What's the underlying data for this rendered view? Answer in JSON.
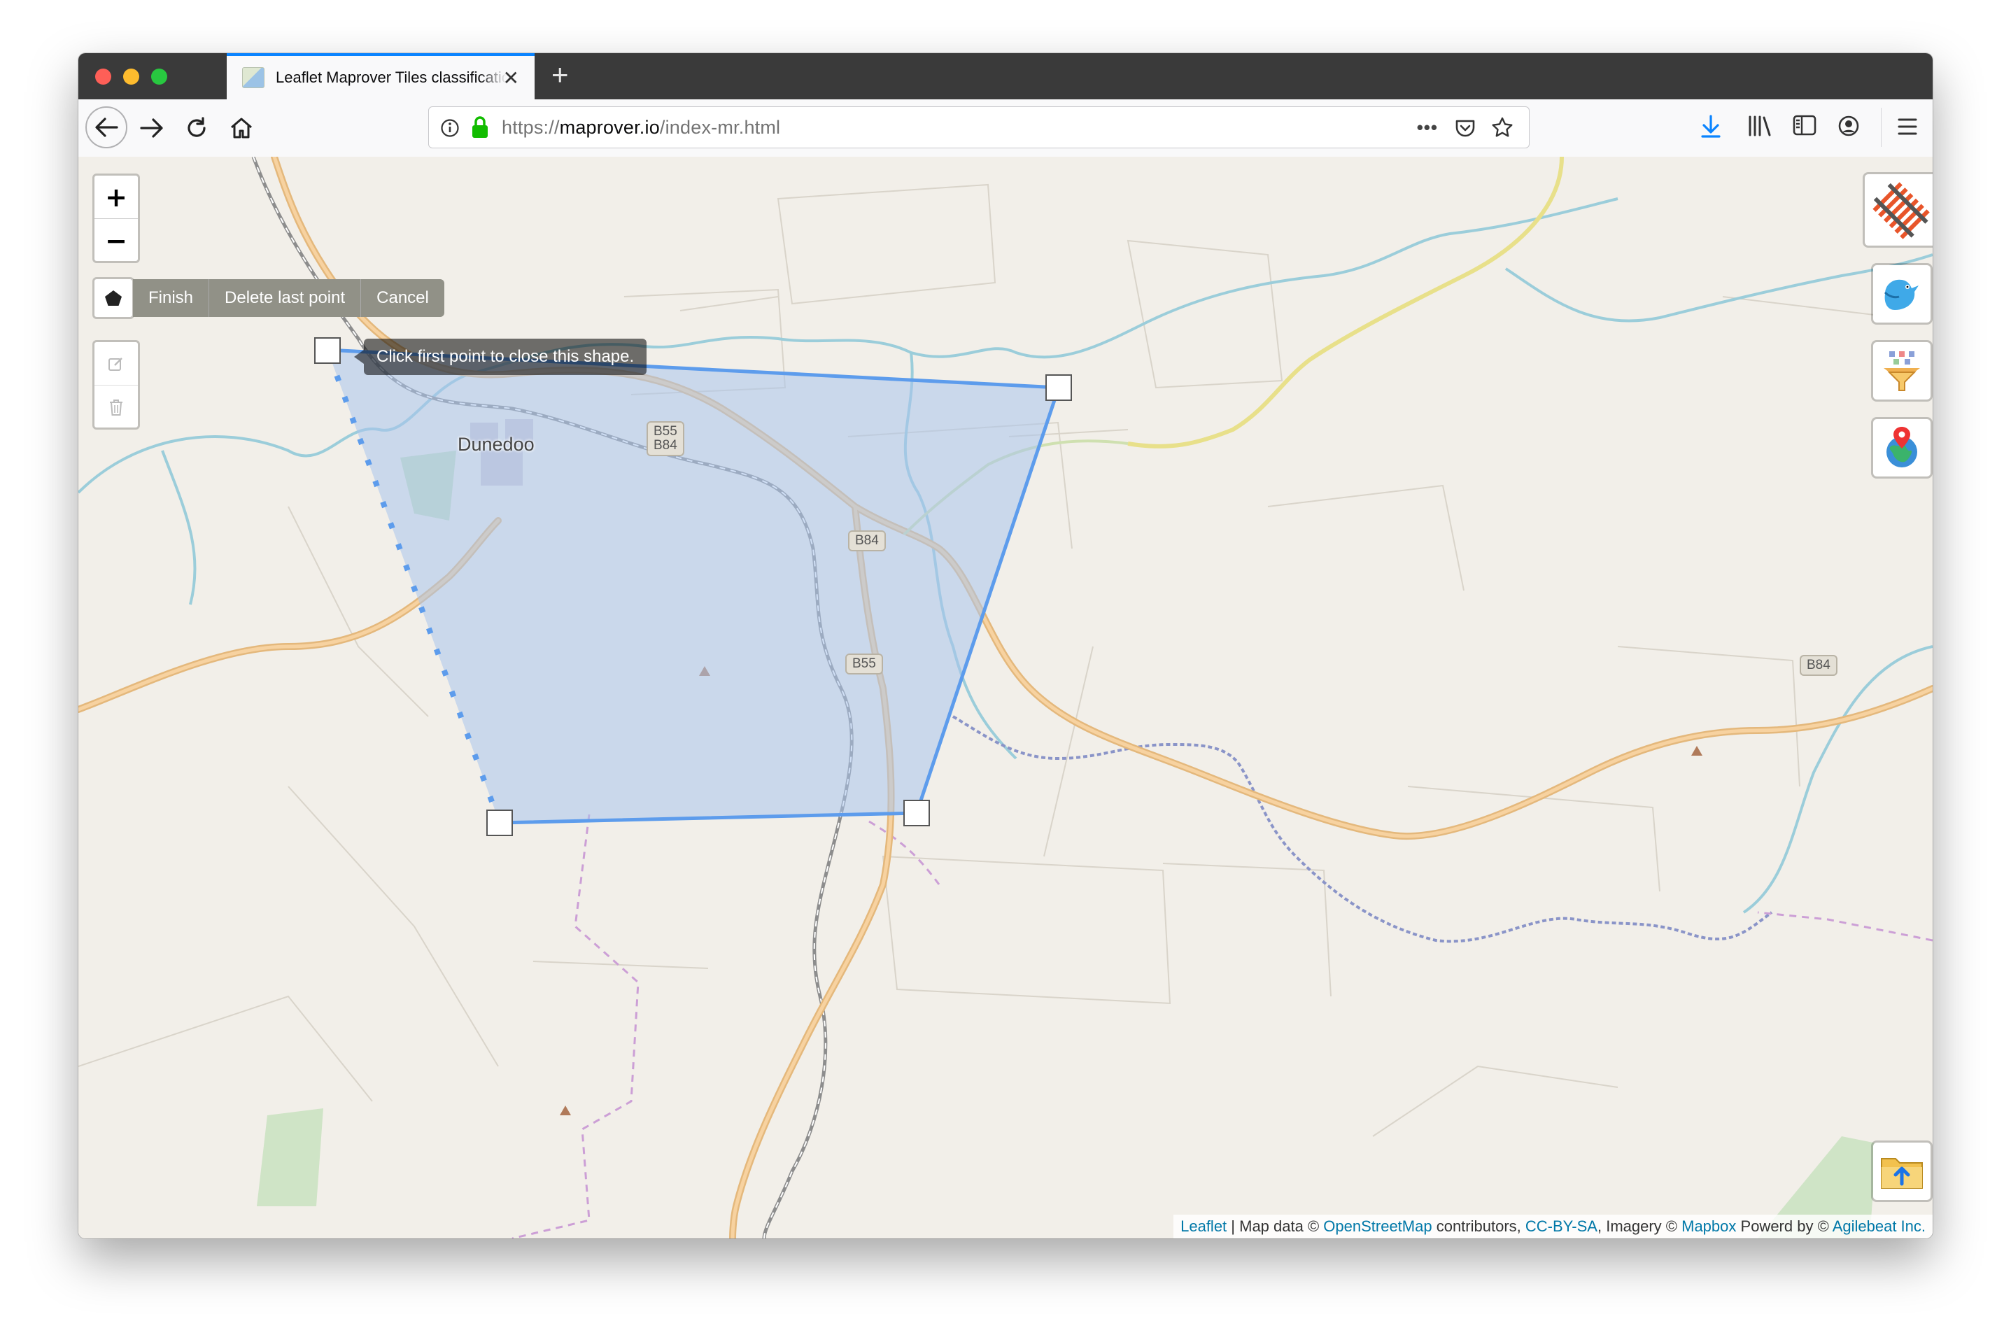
{
  "browser": {
    "tab_title": "Leaflet Maprover Tiles classification",
    "url_scheme": "https://",
    "url_host": "maprover.io",
    "url_path": "/index-mr.html"
  },
  "map": {
    "zoom_in_label": "+",
    "zoom_out_label": "−",
    "draw_actions": {
      "finish": "Finish",
      "delete_last": "Delete last point",
      "cancel": "Cancel"
    },
    "tooltip": "Click first point to close this shape.",
    "town_label": "Dunedoo",
    "road_labels": [
      "B55",
      "B84",
      "B84",
      "B55",
      "B84"
    ],
    "polygon_fill": "#a9c4ec",
    "polygon_stroke": "#5d9cec",
    "icons": {
      "top_right": [
        "railway-icon",
        "twitter-bird-icon",
        "funnel-icon",
        "globe-pin-icon"
      ],
      "bottom_right": "folder-upload-icon"
    }
  },
  "attribution": {
    "leaflet": "Leaflet",
    "sep1": " | Map data © ",
    "osm": "OpenStreetMap",
    "contrib": " contributors, ",
    "license": "CC-BY-SA",
    "imagery": ", Imagery © ",
    "mapbox": "Mapbox",
    "powered": " Powerd by © ",
    "agilebeat": "Agilebeat Inc."
  }
}
